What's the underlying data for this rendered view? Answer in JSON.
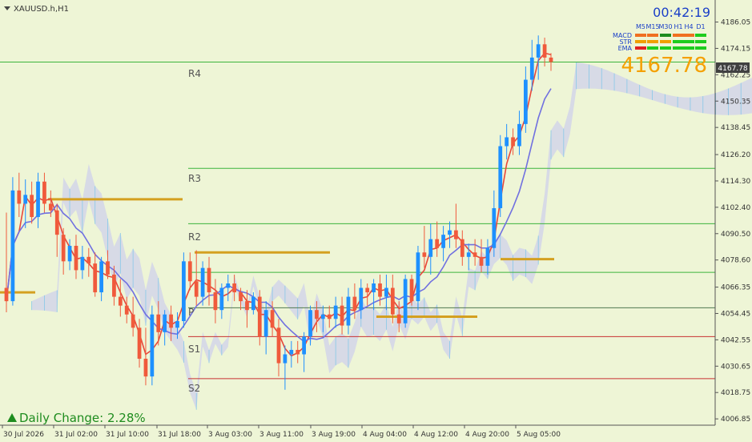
{
  "symbol_label": "XAUUSD.h,H1",
  "timer": "00:42:19",
  "current_price": "4167.78",
  "price_tag": "4167.78",
  "daily_change": "Daily Change: 2.28%",
  "indicators": {
    "timeframes": [
      "M5",
      "M15",
      "M30",
      "H1",
      "H4",
      "D1"
    ],
    "rows": [
      {
        "name": "MACD",
        "colors": [
          "#f07020",
          "#f07020",
          "#1e8c1e",
          "#f07020",
          "#f07020",
          "#1ecc1e"
        ]
      },
      {
        "name": "STR",
        "colors": [
          "#f0a000",
          "#f0a000",
          "#f0a000",
          "#1ecc1e",
          "#1ecc1e",
          "#1ecc1e"
        ]
      },
      {
        "name": "EMA",
        "colors": [
          "#e02020",
          "#1ecc1e",
          "#1ecc1e",
          "#1ecc1e",
          "#1ecc1e",
          "#1ecc1e"
        ]
      }
    ]
  },
  "pivot_labels": {
    "r4": "R4",
    "r3": "R3",
    "r2": "R2",
    "p": "P",
    "s1": "S1",
    "s2": "S2"
  },
  "chart_data": {
    "type": "candlestick",
    "y_ticks": [
      "4186.05",
      "4174.15",
      "4162.25",
      "4150.35",
      "4138.45",
      "4126.20",
      "4114.30",
      "4102.40",
      "4090.50",
      "4078.60",
      "4066.35",
      "4054.45",
      "4042.55",
      "4030.65",
      "4018.75",
      "4006.85"
    ],
    "x_labels": [
      "30 Jul 2026",
      "31 Jul 02:00",
      "31 Jul 10:00",
      "31 Jul 18:00",
      "3 Aug 03:00",
      "3 Aug 11:00",
      "3 Aug 19:00",
      "4 Aug 04:00",
      "4 Aug 12:00",
      "4 Aug 20:00",
      "5 Aug 05:00"
    ],
    "ylim": [
      4004,
      4196
    ],
    "levels": {
      "R4": 4168,
      "R3": 4120,
      "R2": 4095,
      "R1": 4073,
      "P": 4057,
      "S1": 4044,
      "S2": 4025
    },
    "colors": {
      "bull": "#1e90ff",
      "bear": "#f05a3c",
      "tenkan": "#e8473a",
      "kijun": "#7070e0",
      "cloud": "#c8c8f0",
      "pivot_up": "#3cb43c",
      "pivot_down": "#c83232",
      "gold": "#d4a020"
    },
    "candles": [
      [
        4066,
        4100,
        4055,
        4060
      ],
      [
        4060,
        4116,
        4058,
        4110
      ],
      [
        4110,
        4118,
        4098,
        4104
      ],
      [
        4104,
        4115,
        4093,
        4108
      ],
      [
        4108,
        4114,
        4095,
        4098
      ],
      [
        4098,
        4118,
        4093,
        4114
      ],
      [
        4114,
        4118,
        4100,
        4104
      ],
      [
        4104,
        4110,
        4098,
        4101
      ],
      [
        4101,
        4104,
        4080,
        4090
      ],
      [
        4090,
        4093,
        4072,
        4078
      ],
      [
        4078,
        4088,
        4074,
        4085
      ],
      [
        4085,
        4090,
        4070,
        4074
      ],
      [
        4074,
        4085,
        4070,
        4080
      ],
      [
        4080,
        4084,
        4071,
        4077
      ],
      [
        4077,
        4082,
        4062,
        4064
      ],
      [
        4064,
        4080,
        4060,
        4078
      ],
      [
        4078,
        4083,
        4070,
        4072
      ],
      [
        4072,
        4076,
        4058,
        4062
      ],
      [
        4062,
        4070,
        4053,
        4058
      ],
      [
        4058,
        4062,
        4050,
        4054
      ],
      [
        4054,
        4062,
        4044,
        4048
      ],
      [
        4048,
        4052,
        4030,
        4034
      ],
      [
        4034,
        4048,
        4022,
        4026
      ],
      [
        4026,
        4058,
        4022,
        4054
      ],
      [
        4054,
        4060,
        4040,
        4046
      ],
      [
        4046,
        4056,
        4040,
        4054
      ],
      [
        4054,
        4058,
        4042,
        4048
      ],
      [
        4048,
        4055,
        4043,
        4051
      ],
      [
        4051,
        4082,
        4048,
        4078
      ],
      [
        4078,
        4082,
        4065,
        4069
      ],
      [
        4069,
        4083,
        4058,
        4062
      ],
      [
        4062,
        4078,
        4058,
        4075
      ],
      [
        4075,
        4080,
        4058,
        4064
      ],
      [
        4064,
        4070,
        4050,
        4056
      ],
      [
        4056,
        4068,
        4052,
        4066
      ],
      [
        4066,
        4072,
        4060,
        4068
      ],
      [
        4068,
        4072,
        4060,
        4064
      ],
      [
        4064,
        4066,
        4056,
        4060
      ],
      [
        4060,
        4065,
        4048,
        4056
      ],
      [
        4056,
        4064,
        4054,
        4062
      ],
      [
        4062,
        4065,
        4040,
        4044
      ],
      [
        4044,
        4060,
        4036,
        4056
      ],
      [
        4056,
        4060,
        4044,
        4048
      ],
      [
        4048,
        4052,
        4026,
        4032
      ],
      [
        4032,
        4040,
        4020,
        4036
      ],
      [
        4036,
        4042,
        4030,
        4038
      ],
      [
        4038,
        4042,
        4032,
        4036
      ],
      [
        4036,
        4046,
        4028,
        4044
      ],
      [
        4044,
        4058,
        4040,
        4056
      ],
      [
        4056,
        4060,
        4046,
        4052
      ],
      [
        4052,
        4058,
        4046,
        4054
      ],
      [
        4054,
        4058,
        4048,
        4052
      ],
      [
        4052,
        4062,
        4048,
        4058
      ],
      [
        4058,
        4062,
        4045,
        4049
      ],
      [
        4049,
        4066,
        4045,
        4062
      ],
      [
        4062,
        4068,
        4052,
        4056
      ],
      [
        4056,
        4070,
        4052,
        4066
      ],
      [
        4066,
        4068,
        4058,
        4064
      ],
      [
        4064,
        4070,
        4056,
        4068
      ],
      [
        4068,
        4072,
        4058,
        4062
      ],
      [
        4062,
        4072,
        4056,
        4066
      ],
      [
        4066,
        4072,
        4050,
        4054
      ],
      [
        4054,
        4060,
        4046,
        4050
      ],
      [
        4050,
        4072,
        4048,
        4070
      ],
      [
        4070,
        4072,
        4058,
        4060
      ],
      [
        4060,
        4085,
        4056,
        4082
      ],
      [
        4082,
        4094,
        4075,
        4080
      ],
      [
        4080,
        4095,
        4072,
        4088
      ],
      [
        4088,
        4096,
        4080,
        4084
      ],
      [
        4084,
        4094,
        4078,
        4090
      ],
      [
        4090,
        4096,
        4084,
        4092
      ],
      [
        4092,
        4104,
        4084,
        4088
      ],
      [
        4088,
        4092,
        4076,
        4080
      ],
      [
        4080,
        4086,
        4074,
        4082
      ],
      [
        4082,
        4088,
        4076,
        4080
      ],
      [
        4080,
        4088,
        4073,
        4076
      ],
      [
        4076,
        4088,
        4072,
        4084
      ],
      [
        4084,
        4110,
        4080,
        4102
      ],
      [
        4102,
        4135,
        4098,
        4130
      ],
      [
        4130,
        4140,
        4124,
        4134
      ],
      [
        4134,
        4138,
        4126,
        4130
      ],
      [
        4130,
        4146,
        4126,
        4140
      ],
      [
        4140,
        4166,
        4136,
        4160
      ],
      [
        4160,
        4178,
        4155,
        4170
      ],
      [
        4170,
        4180,
        4160,
        4176
      ],
      [
        4176,
        4179,
        4166,
        4170
      ],
      [
        4170,
        4172,
        4164,
        4168
      ]
    ]
  }
}
